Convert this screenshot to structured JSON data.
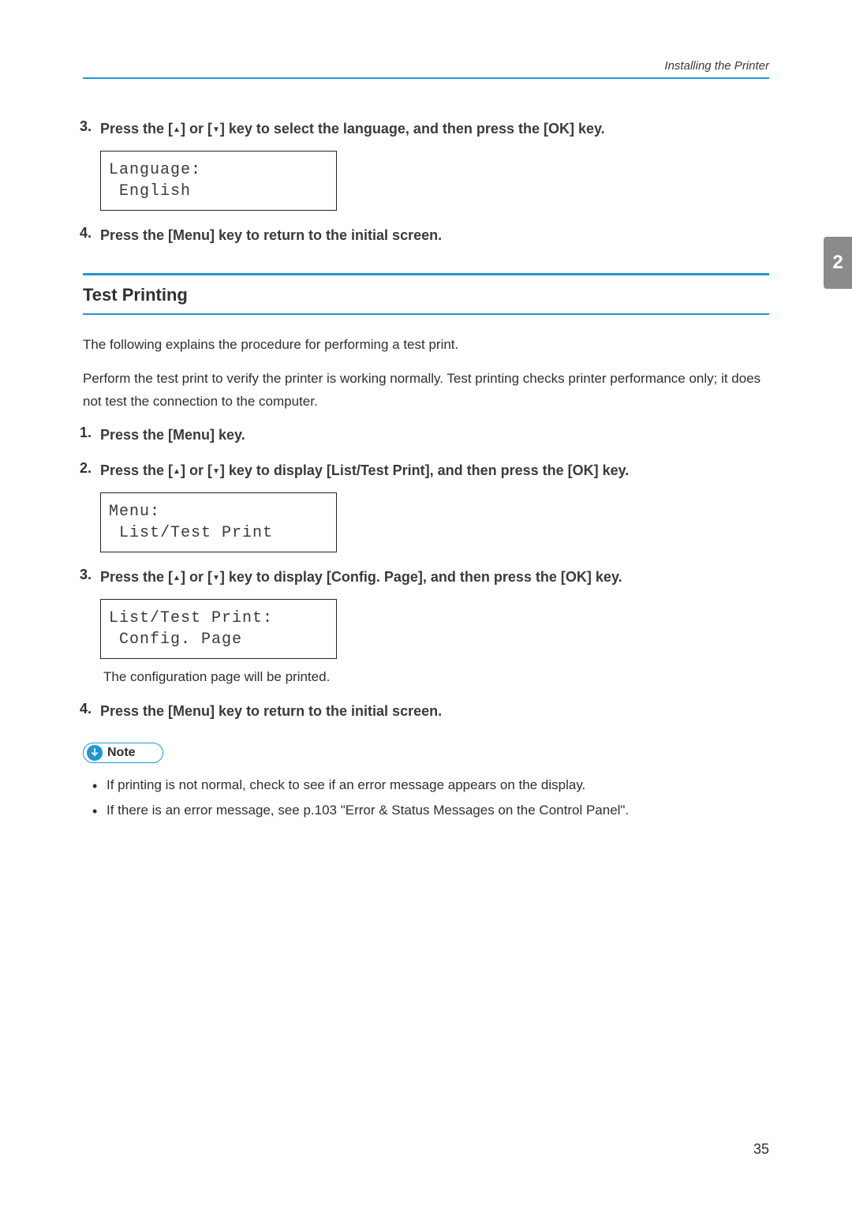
{
  "header": {
    "breadcrumb": "Installing the Printer"
  },
  "chapter_tab": "2",
  "top_steps": [
    {
      "num": "3.",
      "text_pre": "Press the [",
      "text_mid1": "] or [",
      "text_mid2": "] key to select the language, and then press the [OK] key.",
      "lcd": "Language:\n English"
    },
    {
      "num": "4.",
      "text": "Press the [Menu] key to return to the initial screen."
    }
  ],
  "section": {
    "title": "Test Printing",
    "para1": "The following explains the procedure for performing a test print.",
    "para2": "Perform the test print to verify the printer is working normally. Test printing checks printer performance only; it does not test the connection to the computer.",
    "steps": [
      {
        "num": "1.",
        "text": "Press the [Menu] key."
      },
      {
        "num": "2.",
        "text_pre": "Press the [",
        "text_mid1": "] or [",
        "text_mid2": "] key to display [List/Test Print], and then press the [OK] key.",
        "lcd": "Menu:\n List/Test Print"
      },
      {
        "num": "3.",
        "text_pre": "Press the [",
        "text_mid1": "] or [",
        "text_mid2": "] key to display [Config. Page], and then press the [OK] key.",
        "lcd": "List/Test Print:\n Config. Page",
        "sub": "The configuration page will be printed."
      },
      {
        "num": "4.",
        "text": "Press the [Menu] key to return to the initial screen."
      }
    ]
  },
  "note": {
    "label": "Note",
    "bullets": [
      "If printing is not normal, check to see if an error message appears on the display.",
      "If there is an error message, see p.103 \"Error & Status Messages on the Control Panel\"."
    ]
  },
  "page_number": "35"
}
